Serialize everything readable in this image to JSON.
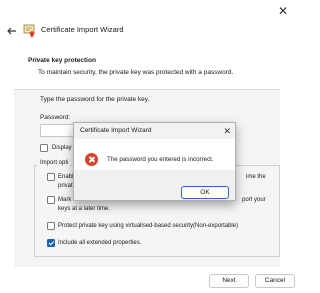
{
  "window": {
    "title": "Certificate Import Wizard",
    "close_glyph": "✕",
    "back_icon": "back-arrow-icon",
    "app_icon": "certificate-icon"
  },
  "header": {
    "title": "Private key protection",
    "description": "To maintain security, the private key was protected with a password."
  },
  "form": {
    "prompt": "Type the password for the private key.",
    "password_label": "Password:",
    "password_value": "",
    "display_label": "Display",
    "options_label": "Import opti",
    "options": [
      {
        "label": "Enable",
        "label_right": "ime the",
        "label_line2": "privat",
        "checked": false
      },
      {
        "label": "Mark",
        "label_right": "port your",
        "label_line2": "keys at a later time.",
        "checked": false
      },
      {
        "label": "Protect private key using virtualised-based security(Non-exportable)",
        "checked": false
      },
      {
        "label": "Include all extended properties.",
        "checked": true
      }
    ]
  },
  "footer": {
    "next_label": "Next",
    "cancel_label": "Cancel"
  },
  "dialog": {
    "title": "Certificate Import Wizard",
    "close_glyph": "✕",
    "icon": "error-icon",
    "message": "The password you entered is incorrect.",
    "ok_label": "OK"
  },
  "colors": {
    "accent": "#1a5fb4",
    "error": "#d9412c"
  }
}
